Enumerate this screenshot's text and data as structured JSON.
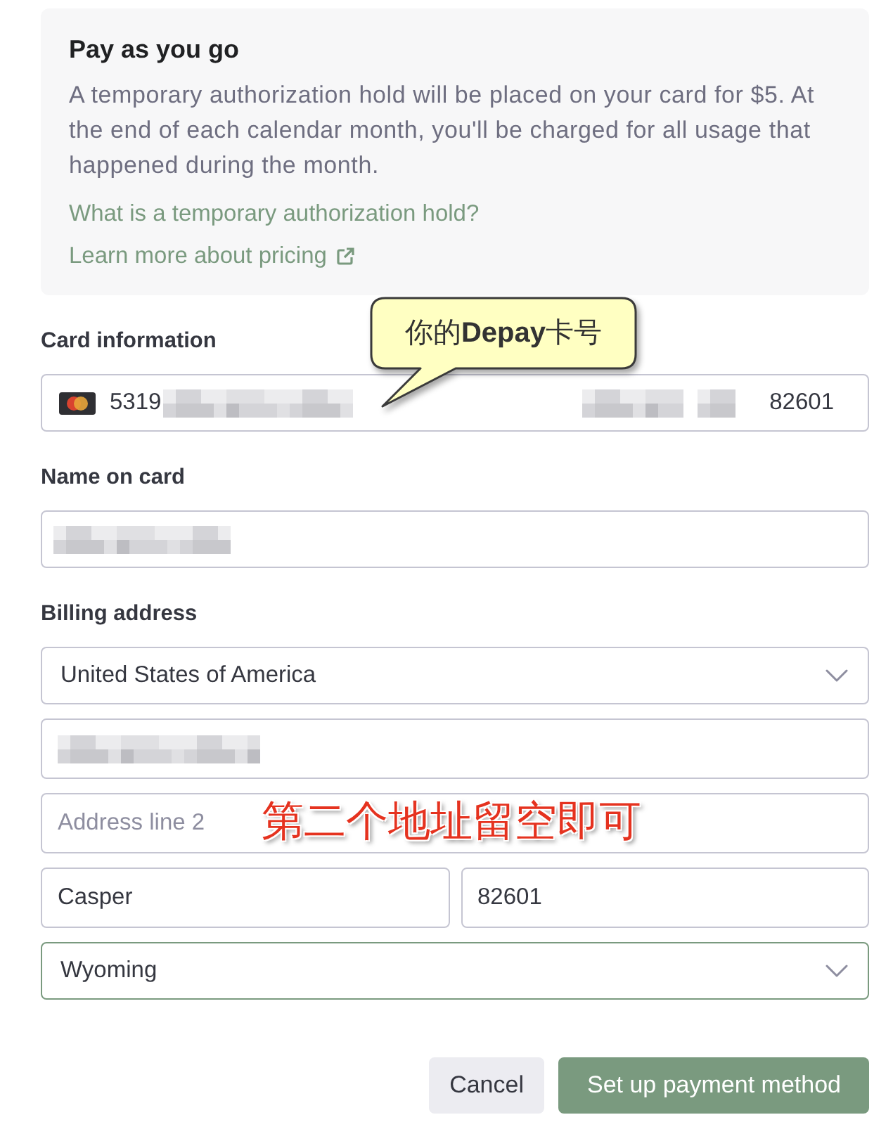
{
  "info_card": {
    "title": "Pay as you go",
    "body": "A temporary authorization hold will be placed on your card for $5. At the end of each calendar month, you'll be charged for all usage that happened during the month.",
    "links": [
      {
        "text": "What is a temporary authorization hold?",
        "external": false
      },
      {
        "text": "Learn more about pricing",
        "external": true
      }
    ]
  },
  "card_information": {
    "label": "Card information",
    "number_start": "5319",
    "number_redacted": true,
    "middle_redacted": true,
    "zip": "82601"
  },
  "name_on_card": {
    "label": "Name on card",
    "redacted": true
  },
  "billing_address": {
    "label": "Billing address",
    "rows": [
      [
        {
          "kind": "select",
          "value": "United States of America",
          "focused": false
        }
      ],
      [
        {
          "kind": "input",
          "redacted": true,
          "focused": false
        }
      ],
      [
        {
          "kind": "input",
          "placeholder": "Address line 2",
          "focused": false
        }
      ],
      [
        {
          "kind": "input",
          "value": "Casper",
          "focused": false
        },
        {
          "kind": "input",
          "value": "82601",
          "focused": false
        }
      ],
      [
        {
          "kind": "select",
          "value": "Wyoming",
          "focused": true
        }
      ]
    ]
  },
  "buttons": [
    {
      "label": "Cancel",
      "kind": "secondary"
    },
    {
      "label": "Set up payment method",
      "kind": "primary"
    }
  ],
  "annotations": [
    {
      "kind": "callout",
      "text": "你的**Depay**卡号"
    },
    {
      "kind": "overlay",
      "text": "第二个地址留空即可"
    }
  ]
}
